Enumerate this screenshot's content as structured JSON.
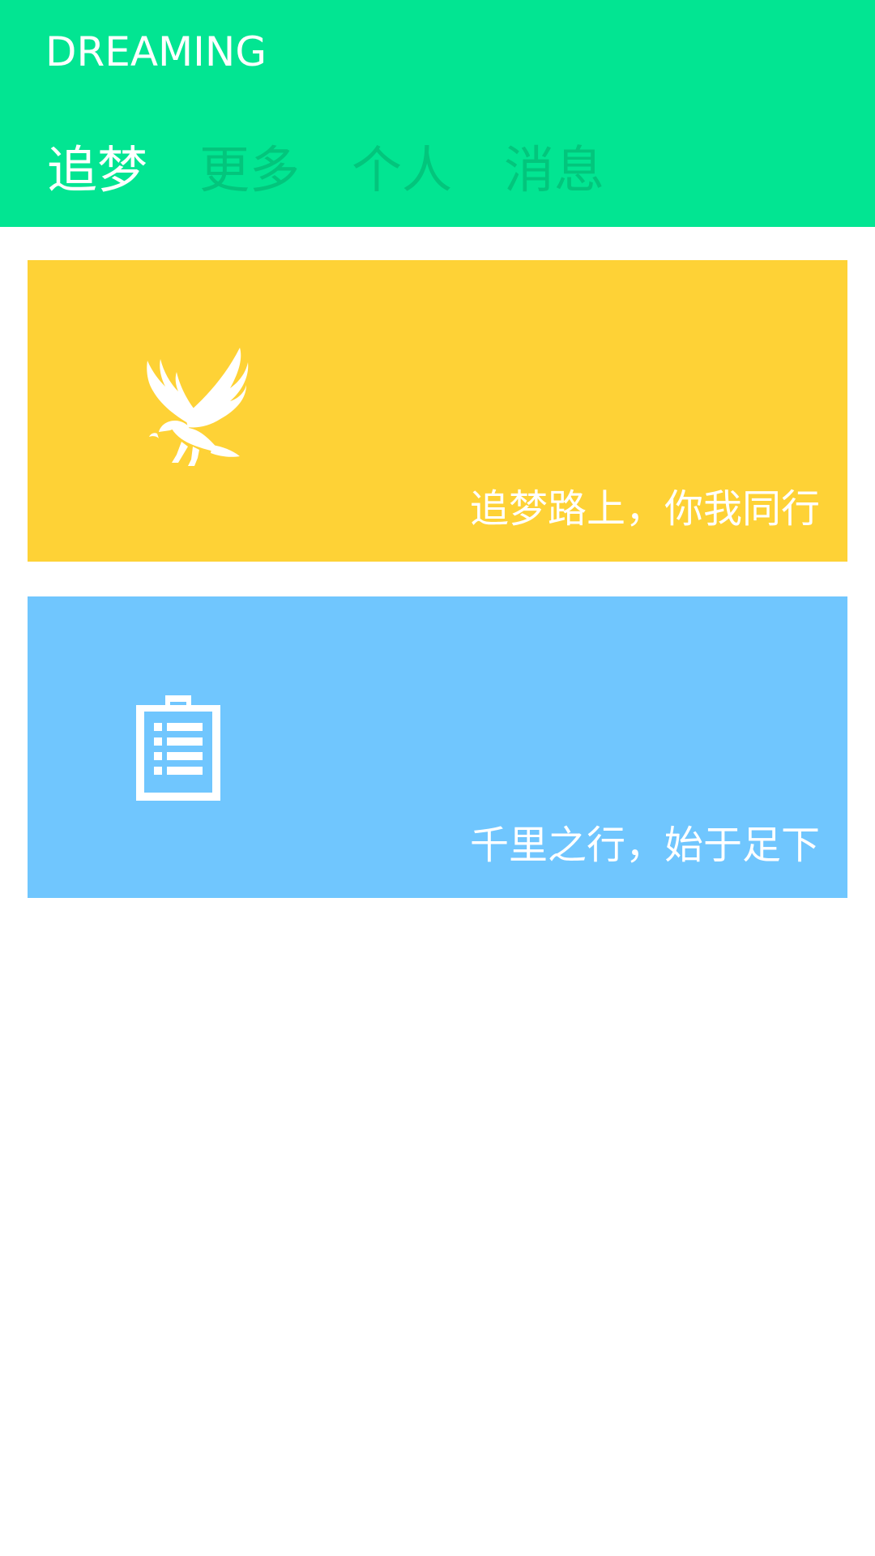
{
  "app": {
    "title": "DREAMING"
  },
  "tabs": [
    {
      "label": "追梦",
      "active": true
    },
    {
      "label": "更多",
      "active": false
    },
    {
      "label": "个人",
      "active": false
    },
    {
      "label": "消息",
      "active": false
    }
  ],
  "cards": [
    {
      "caption": "追梦路上，你我同行",
      "icon": "eagle-icon",
      "color": "#fed236"
    },
    {
      "caption": "千里之行，始于足下",
      "icon": "clipboard-icon",
      "color": "#70c6fe"
    }
  ],
  "colors": {
    "header": "#02e592",
    "tab_active": "#ffffff",
    "tab_inactive": "#03c57c",
    "background": "#ffffff"
  }
}
